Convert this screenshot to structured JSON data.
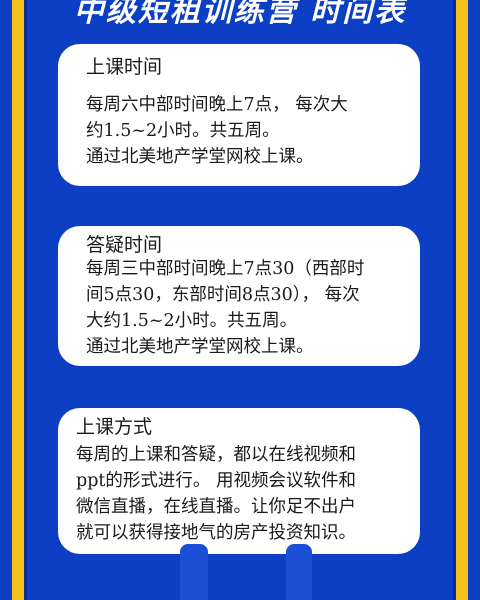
{
  "header": {
    "title": "中级短租训练营 时间表"
  },
  "cards": [
    {
      "title": "上课时间",
      "lines": [
        "每周六中部时间晚上7点， 每次大",
        "约1.5~2小时。共五周。",
        "通过北美地产学堂网校上课。"
      ]
    },
    {
      "title": "答疑时间",
      "lines": [
        "每周三中部时间晚上7点30（西部时",
        "间5点30，东部时间8点30）， 每次",
        "大约1.5~2小时。共五周。",
        "通过北美地产学堂网校上课。"
      ]
    },
    {
      "title": "上课方式",
      "lines": [
        "每周的上课和答疑，都以在线视频和",
        "ppt的形式进行。 用视频会议软件和",
        "微信直播，在线直播。让你足不出户",
        "就可以获得接地气的房产投资知识。"
      ]
    }
  ],
  "colors": {
    "background": "#0d3fc4",
    "stripe": "#f3c21f",
    "card": "#ffffff",
    "text": "#1a1a1a"
  }
}
